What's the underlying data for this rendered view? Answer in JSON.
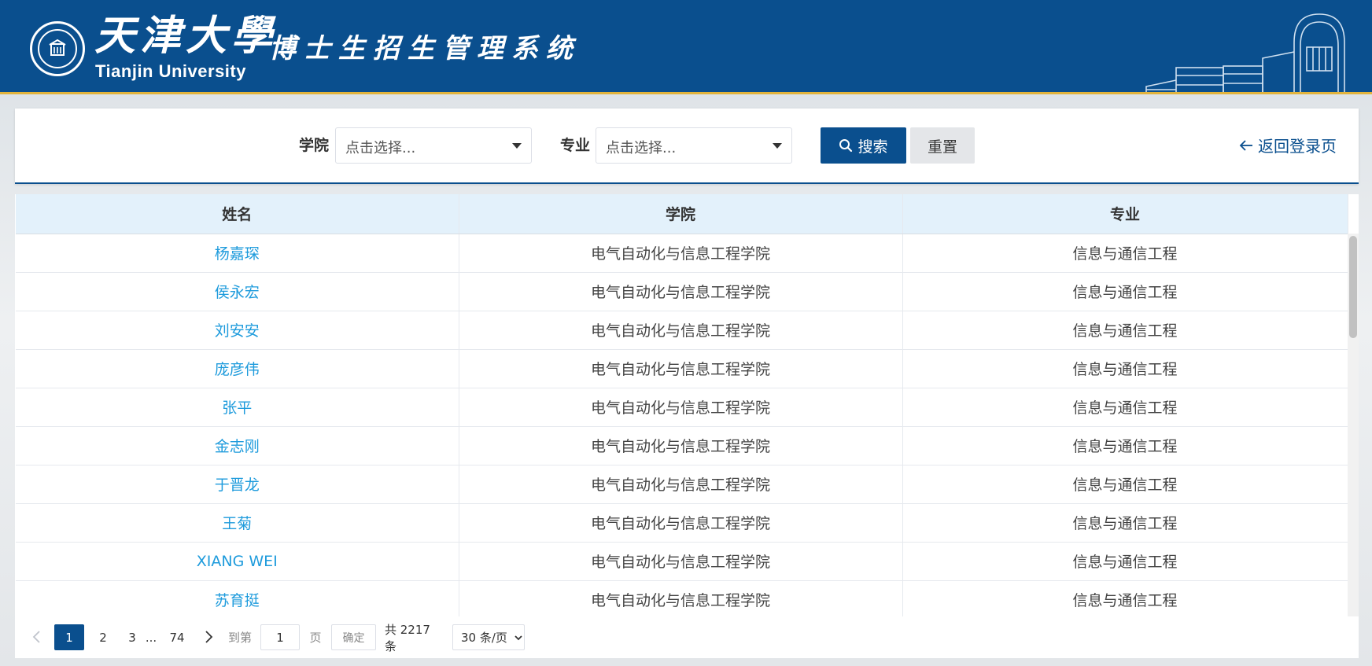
{
  "header": {
    "university_cn": "天津大學",
    "university_en": "Tianjin University",
    "system_title": "博士生招生管理系统"
  },
  "search": {
    "college_label": "学院",
    "college_placeholder": "点击选择...",
    "major_label": "专业",
    "major_placeholder": "点击选择...",
    "search_button": "搜索",
    "reset_button": "重置",
    "back_link": "返回登录页"
  },
  "table": {
    "columns": [
      "姓名",
      "学院",
      "专业"
    ],
    "rows": [
      {
        "name": "杨嘉琛",
        "college": "电气自动化与信息工程学院",
        "major": "信息与通信工程"
      },
      {
        "name": "侯永宏",
        "college": "电气自动化与信息工程学院",
        "major": "信息与通信工程"
      },
      {
        "name": "刘安安",
        "college": "电气自动化与信息工程学院",
        "major": "信息与通信工程"
      },
      {
        "name": "庞彦伟",
        "college": "电气自动化与信息工程学院",
        "major": "信息与通信工程"
      },
      {
        "name": "张平",
        "college": "电气自动化与信息工程学院",
        "major": "信息与通信工程"
      },
      {
        "name": "金志刚",
        "college": "电气自动化与信息工程学院",
        "major": "信息与通信工程"
      },
      {
        "name": "于晋龙",
        "college": "电气自动化与信息工程学院",
        "major": "信息与通信工程"
      },
      {
        "name": "王菊",
        "college": "电气自动化与信息工程学院",
        "major": "信息与通信工程"
      },
      {
        "name": "XIANG WEI",
        "college": "电气自动化与信息工程学院",
        "major": "信息与通信工程"
      },
      {
        "name": "苏育挺",
        "college": "电气自动化与信息工程学院",
        "major": "信息与通信工程"
      }
    ]
  },
  "pagination": {
    "current": "1",
    "pages": [
      "2",
      "3"
    ],
    "ellipsis": "...",
    "last": "74",
    "goto_label": "到第",
    "goto_value": "1",
    "page_unit": "页",
    "confirm": "确定",
    "total": "共 2217 条",
    "page_size": "30 条/页"
  },
  "colors": {
    "primary": "#0a4f8e",
    "accent_gold": "#e2b43d",
    "link": "#1e9bdc",
    "table_header_bg": "#e3f1fb"
  }
}
